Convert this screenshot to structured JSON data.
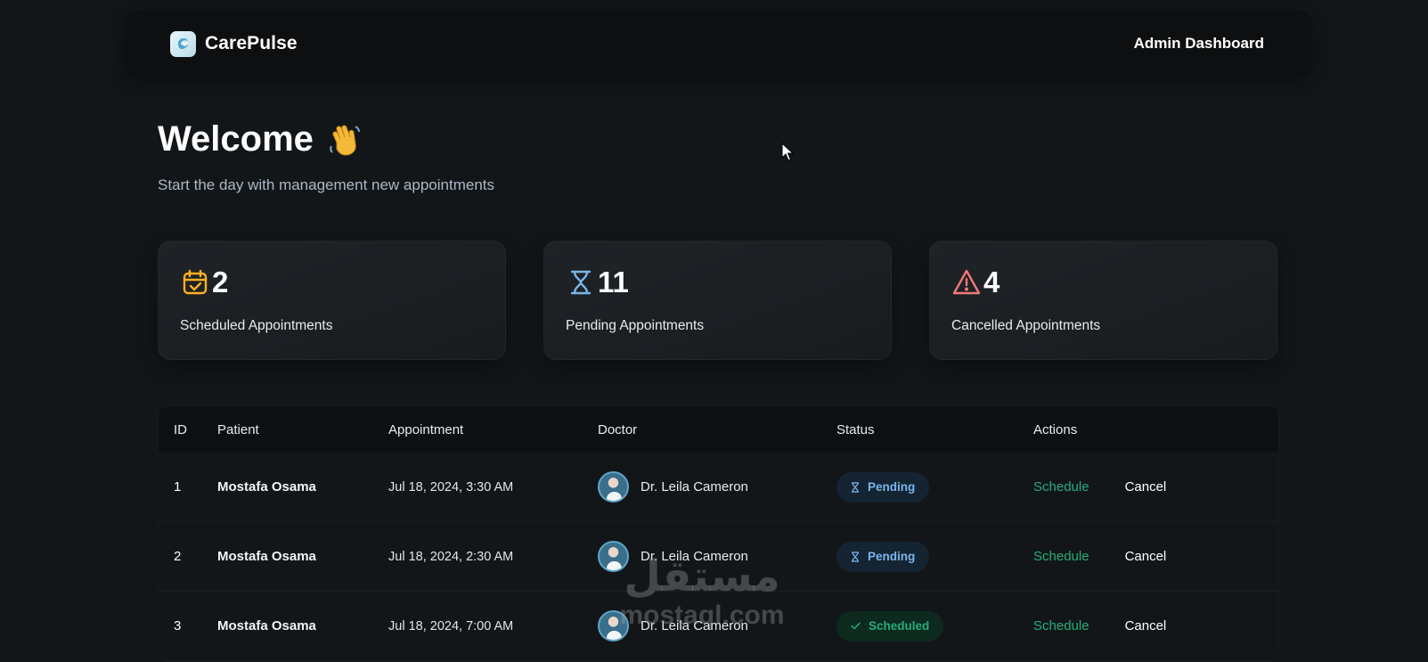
{
  "header": {
    "brand": "CarePulse",
    "title": "Admin Dashboard"
  },
  "welcome": {
    "title": "Welcome",
    "emoji_icon": "waving-hand-icon",
    "subtitle": "Start the day with management new appointments"
  },
  "stats": [
    {
      "icon": "calendar-check-icon",
      "color": "#FFB020",
      "count": "2",
      "label": "Scheduled Appointments"
    },
    {
      "icon": "hourglass-icon",
      "color": "#79B5EC",
      "count": "11",
      "label": "Pending Appointments"
    },
    {
      "icon": "warning-triangle-icon",
      "color": "#F37877",
      "count": "4",
      "label": "Cancelled Appointments"
    }
  ],
  "table": {
    "headers": [
      "ID",
      "Patient",
      "Appointment",
      "Doctor",
      "Status",
      "Actions"
    ],
    "rows": [
      {
        "id": "1",
        "patient": "Mostafa Osama",
        "appointment": "Jul 18, 2024, 3:30 AM",
        "doctor": "Dr. Leila Cameron",
        "status": "Pending",
        "status_type": "pending",
        "action_schedule": "Schedule",
        "action_cancel": "Cancel"
      },
      {
        "id": "2",
        "patient": "Mostafa Osama",
        "appointment": "Jul 18, 2024, 2:30 AM",
        "doctor": "Dr. Leila Cameron",
        "status": "Pending",
        "status_type": "pending",
        "action_schedule": "Schedule",
        "action_cancel": "Cancel"
      },
      {
        "id": "3",
        "patient": "Mostafa Osama",
        "appointment": "Jul 18, 2024, 7:00 AM",
        "doctor": "Dr. Leila Cameron",
        "status": "Scheduled",
        "status_type": "scheduled",
        "action_schedule": "Schedule",
        "action_cancel": "Cancel"
      }
    ]
  },
  "watermark": {
    "arabic": "مستقل",
    "latin": "mostaql.com"
  },
  "colors": {
    "background": "#131619",
    "header": "#0D0F10",
    "accent_green": "#24AE7C",
    "pending_blue": "#79B5EC"
  }
}
